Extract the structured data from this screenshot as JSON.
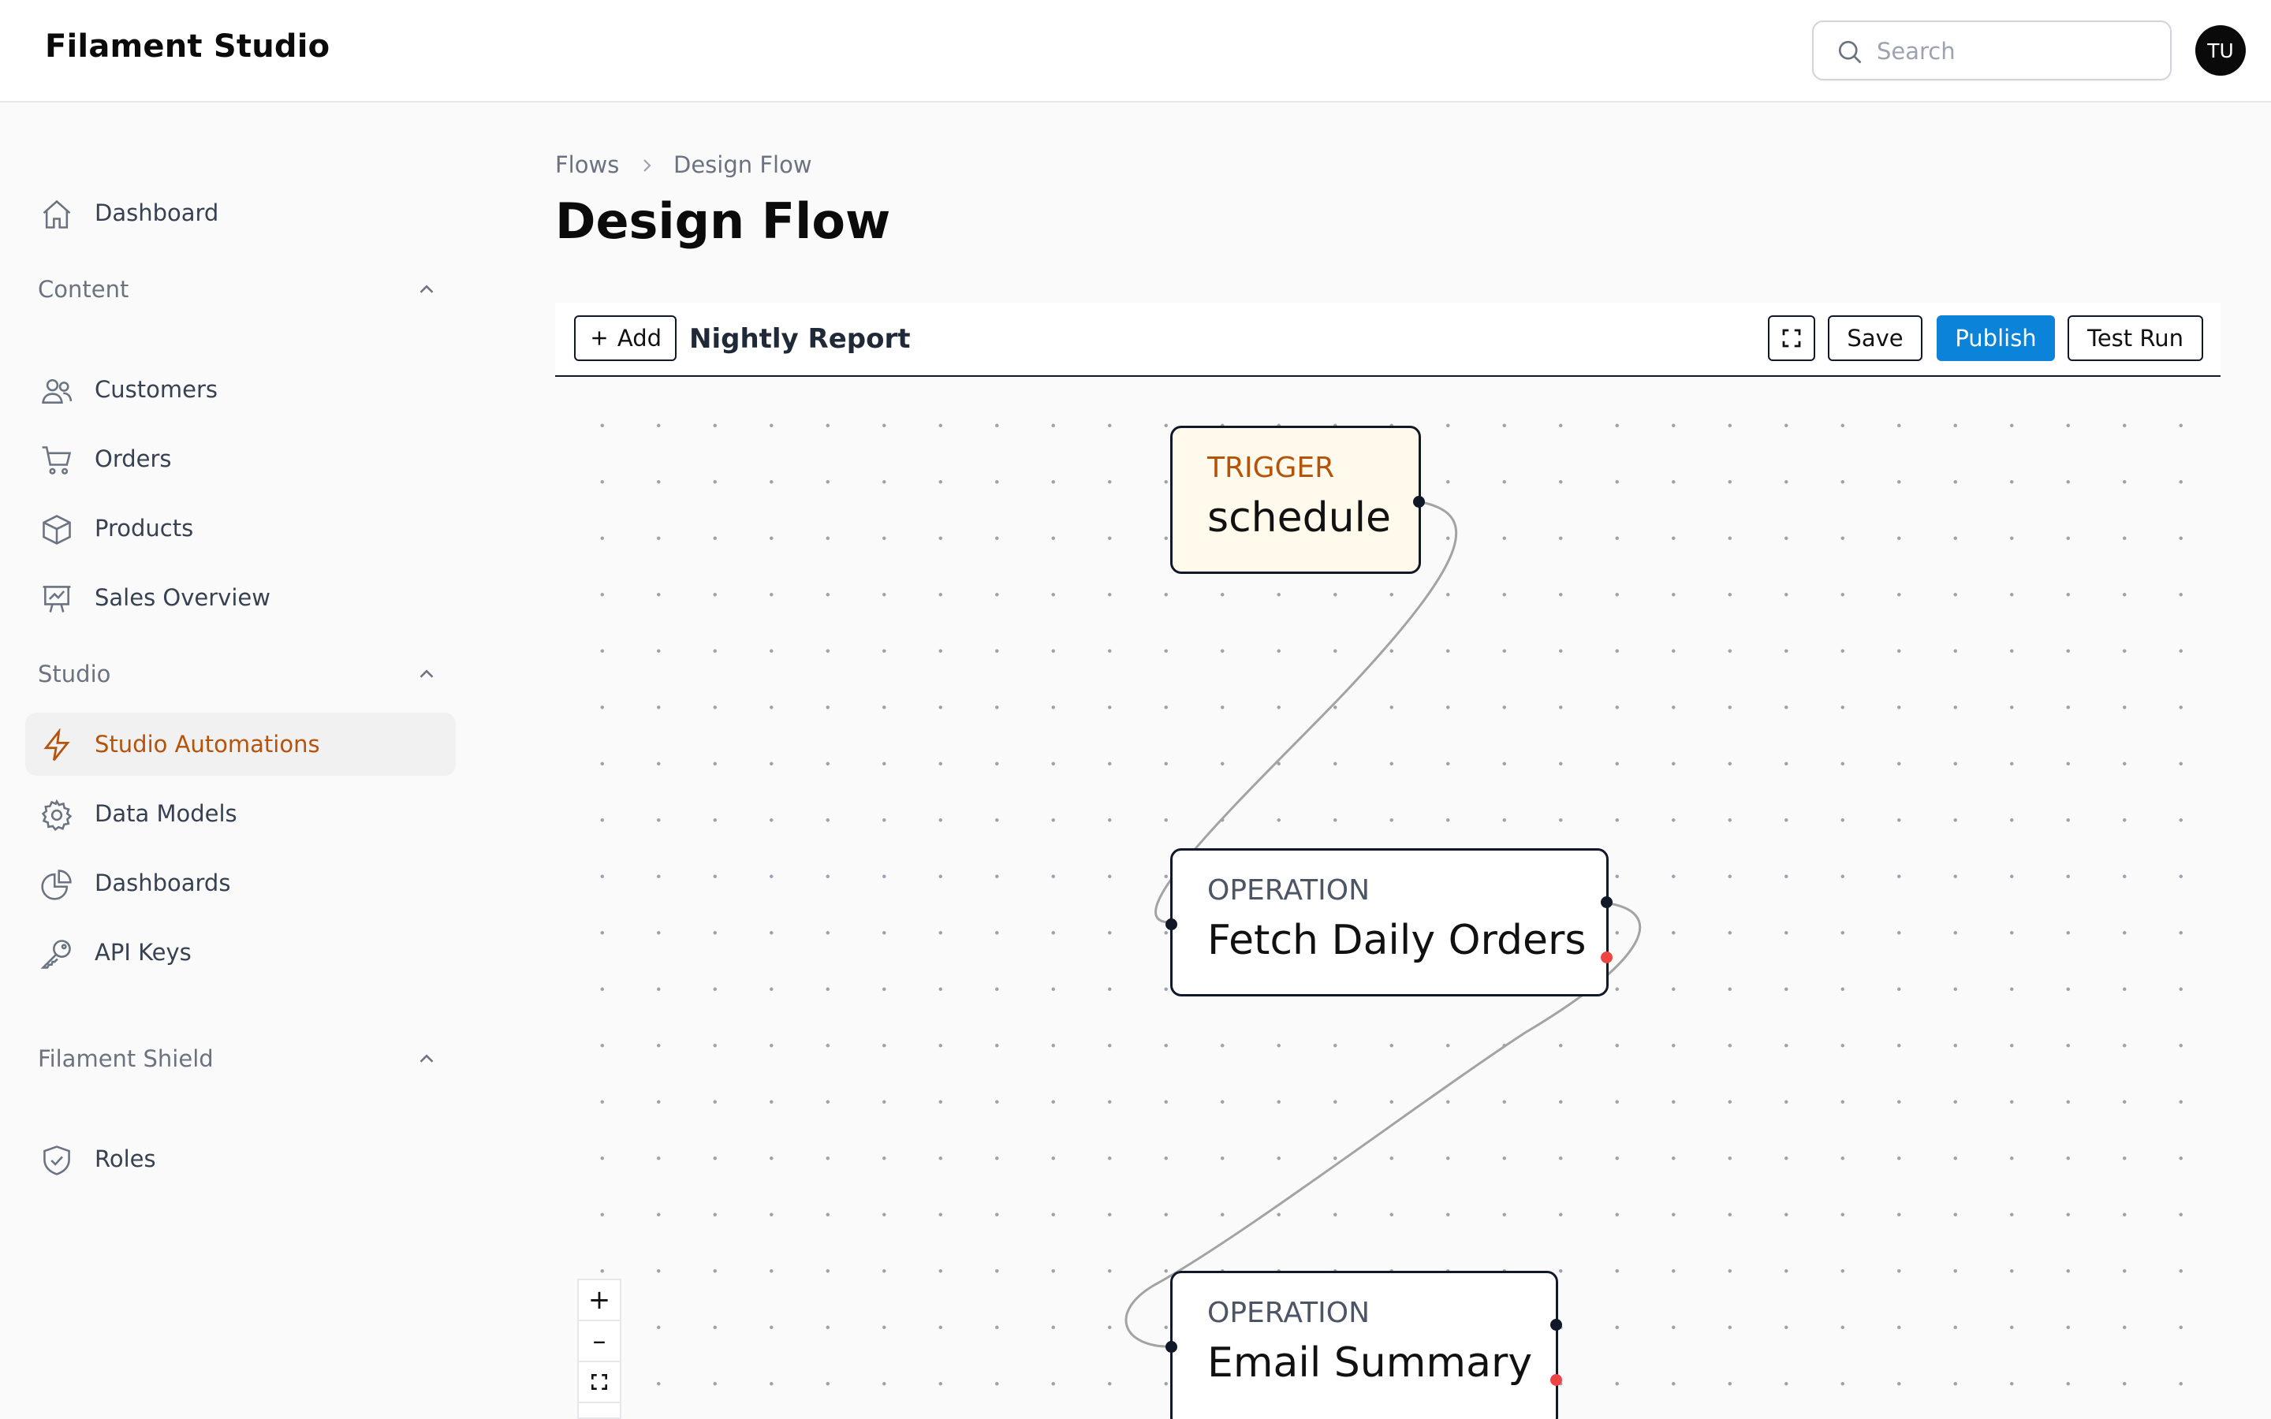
{
  "header": {
    "brand": "Filament Studio",
    "search_placeholder": "Search",
    "avatar_initials": "TU"
  },
  "sidebar": {
    "top_items": [
      {
        "label": "Dashboard",
        "icon": "home-icon"
      }
    ],
    "groups": [
      {
        "label": "Content",
        "items": [
          {
            "label": "Customers",
            "icon": "users-icon"
          },
          {
            "label": "Orders",
            "icon": "cart-icon"
          },
          {
            "label": "Products",
            "icon": "cube-icon"
          },
          {
            "label": "Sales Overview",
            "icon": "presentation-chart-icon"
          }
        ]
      },
      {
        "label": "Studio",
        "items": [
          {
            "label": "Studio Automations",
            "icon": "bolt-icon",
            "active": true
          },
          {
            "label": "Data Models",
            "icon": "cog-icon"
          },
          {
            "label": "Dashboards",
            "icon": "pie-chart-icon"
          },
          {
            "label": "API Keys",
            "icon": "key-icon"
          }
        ]
      },
      {
        "label": "Filament Shield",
        "items": [
          {
            "label": "Roles",
            "icon": "shield-check-icon"
          }
        ]
      }
    ]
  },
  "breadcrumb": [
    "Flows",
    "Design Flow"
  ],
  "page_title": "Design Flow",
  "toolbar": {
    "add_label": "Add",
    "flow_name": "Nightly Report",
    "save_label": "Save",
    "publish_label": "Publish",
    "test_run_label": "Test Run"
  },
  "nodes": [
    {
      "kind": "TRIGGER",
      "title": "schedule"
    },
    {
      "kind": "OPERATION",
      "title": "Fetch Daily Orders"
    },
    {
      "kind": "OPERATION",
      "title": "Email Summary"
    }
  ],
  "colors": {
    "accent": "#b45309",
    "primary": "#0b83d9",
    "trigger_bg": "#fffaeb",
    "error_port": "#ef4444"
  }
}
